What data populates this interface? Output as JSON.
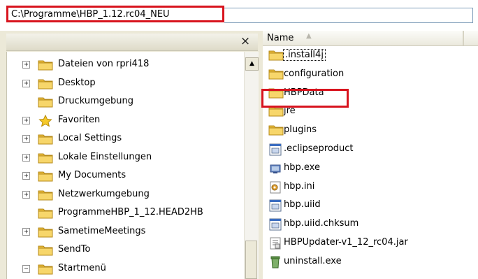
{
  "address": {
    "path": "C:\\Programme\\HBP_1.12.rc04_NEU"
  },
  "folder_pane": {
    "close_label": "×",
    "items": [
      {
        "label": "Dateien von rpri418",
        "expander": "+",
        "icon": "folder"
      },
      {
        "label": "Desktop",
        "expander": "+",
        "icon": "folder"
      },
      {
        "label": "Druckumgebung",
        "expander": "",
        "icon": "folder"
      },
      {
        "label": "Favoriten",
        "expander": "+",
        "icon": "star"
      },
      {
        "label": "Local Settings",
        "expander": "+",
        "icon": "folder"
      },
      {
        "label": "Lokale Einstellungen",
        "expander": "+",
        "icon": "folder"
      },
      {
        "label": "My Documents",
        "expander": "+",
        "icon": "folder"
      },
      {
        "label": "Netzwerkumgebung",
        "expander": "+",
        "icon": "folder"
      },
      {
        "label": "ProgrammeHBP_1_12.HEAD2HB",
        "expander": "",
        "icon": "folder"
      },
      {
        "label": "SametimeMeetings",
        "expander": "+",
        "icon": "folder"
      },
      {
        "label": "SendTo",
        "expander": "",
        "icon": "folder"
      },
      {
        "label": "Startmenü",
        "expander": "−",
        "icon": "folder"
      }
    ]
  },
  "file_list": {
    "column_name": "Name",
    "sort_indicator": "▲",
    "items": [
      {
        "label": ".install4j",
        "icon": "folder"
      },
      {
        "label": "configuration",
        "icon": "folder"
      },
      {
        "label": "HBPData",
        "icon": "folder"
      },
      {
        "label": "jre",
        "icon": "folder"
      },
      {
        "label": "plugins",
        "icon": "folder"
      },
      {
        "label": ".eclipseproduct",
        "icon": "doc"
      },
      {
        "label": "hbp.exe",
        "icon": "exe"
      },
      {
        "label": "hbp.ini",
        "icon": "ini"
      },
      {
        "label": "hbp.uiid",
        "icon": "doc"
      },
      {
        "label": "hbp.uiid.chksum",
        "icon": "doc"
      },
      {
        "label": "HBPUpdater-v1_12_rc04.jar",
        "icon": "jar"
      },
      {
        "label": "uninstall.exe",
        "icon": "uninstall"
      }
    ]
  },
  "colors": {
    "highlight": "#d8141e",
    "folder_yellow": "#f5cf4f"
  }
}
